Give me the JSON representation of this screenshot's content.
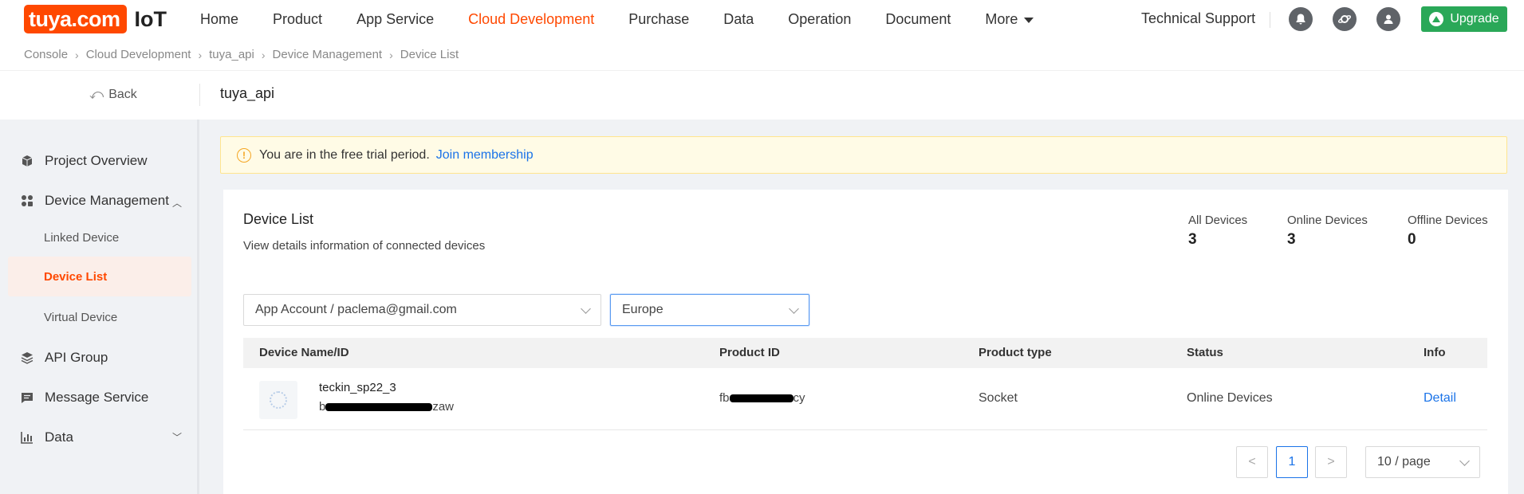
{
  "brand": {
    "logo_text": "tuya.com",
    "product": "IoT"
  },
  "nav": {
    "items": [
      "Home",
      "Product",
      "App Service",
      "Cloud Development",
      "Purchase",
      "Data",
      "Operation",
      "Document",
      "More"
    ],
    "active": "Cloud Development",
    "tech_support": "Technical Support",
    "upgrade": "Upgrade"
  },
  "breadcrumb": [
    "Console",
    "Cloud Development",
    "tuya_api",
    "Device Management",
    "Device List"
  ],
  "subheader": {
    "back": "Back",
    "project": "tuya_api"
  },
  "sidebar": {
    "project_overview": "Project Overview",
    "device_management": "Device Management",
    "linked_device": "Linked Device",
    "device_list": "Device List",
    "virtual_device": "Virtual Device",
    "api_group": "API Group",
    "message_service": "Message Service",
    "data": "Data"
  },
  "banner": {
    "text": "You are in the free trial period.",
    "link": "Join membership"
  },
  "card": {
    "title": "Device List",
    "description": "View details information of connected devices",
    "stats": [
      {
        "label": "All Devices",
        "value": "3"
      },
      {
        "label": "Online Devices",
        "value": "3"
      },
      {
        "label": "Offline Devices",
        "value": "0"
      }
    ],
    "account_select": "App Account / paclema@gmail.com",
    "region_select": "Europe"
  },
  "table": {
    "headers": [
      "Device Name/ID",
      "Product ID",
      "Product type",
      "Status",
      "Info"
    ],
    "rows": [
      {
        "name": "teckin_sp22_3",
        "id_prefix": "b",
        "id_suffix": "zaw",
        "product_id_prefix": "fb",
        "product_id_suffix": "cy",
        "type": "Socket",
        "status": "Online Devices",
        "info": "Detail"
      }
    ]
  },
  "pagination": {
    "prev": "<",
    "page": "1",
    "next": ">",
    "page_size": "10 / page"
  }
}
